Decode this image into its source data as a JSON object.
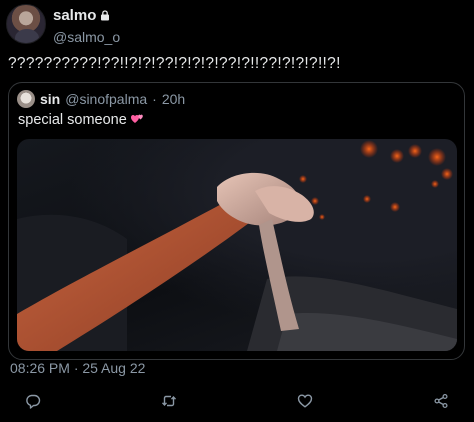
{
  "author": {
    "display_name": "salmo",
    "handle": "@salmo_o",
    "protected": true
  },
  "tweet": {
    "text": "??????????!??!!?!?!??!?!?!?!??!?!!??!?!?!?!!?!"
  },
  "quoted_tweet": {
    "display_name": "sin",
    "handle": "@sinofpalma",
    "separator": "·",
    "relative_time": "20h",
    "text": "special someone"
  },
  "footer": {
    "timestamp": "08:26 PM · 25 Aug 22"
  },
  "icons": {
    "lock": "lock-icon",
    "emoji": "two-hearts-emoji",
    "reply": "reply-icon",
    "retweet": "retweet-icon",
    "like": "like-icon",
    "share": "share-icon"
  },
  "colors": {
    "background": "#000000",
    "primary_text": "#e7e9ea",
    "secondary_text": "#8b98a5",
    "border": "#333639",
    "emoji_pink": "#ff5fa2"
  }
}
